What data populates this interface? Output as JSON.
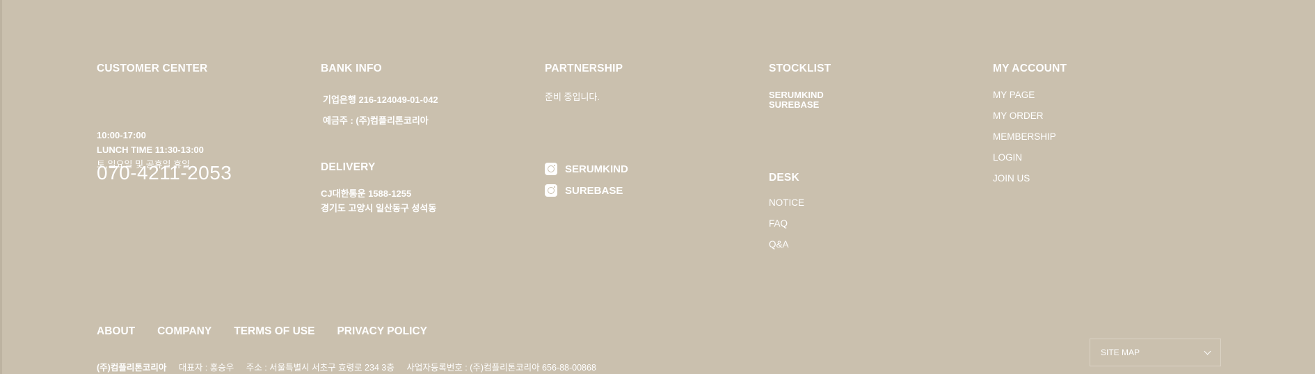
{
  "customer_center": {
    "title": "CUSTOMER CENTER",
    "phone": "070-4211-2053",
    "hours": "10:00-17:00",
    "lunch": "LUNCH TIME 11:30-13:00",
    "closed": "토,일요일 및 공휴일 휴일"
  },
  "bank_info": {
    "title": "BANK INFO",
    "account": "기업은행 216-124049-01-042",
    "holder": "예금주 : (주)컴플리톤코리아"
  },
  "delivery": {
    "title": "DELIVERY",
    "company": "CJ대한통운 1588-1255",
    "address": "경기도 고양시 일산동구 성석동"
  },
  "partnership": {
    "title": "PARTNERSHIP",
    "note": "준비 중입니다.",
    "sns": [
      {
        "label": "SERUMKIND",
        "icon": "instagram-icon"
      },
      {
        "label": "SUREBASE",
        "icon": "instagram-icon"
      }
    ]
  },
  "stocklist": {
    "title": "STOCKLIST",
    "items": [
      "SERUMKIND",
      "SUREBASE"
    ]
  },
  "desk": {
    "title": "DESK",
    "items": [
      "NOTICE",
      "FAQ",
      "Q&A"
    ]
  },
  "my_account": {
    "title": "MY ACCOUNT",
    "items": [
      "MY PAGE",
      "MY ORDER",
      "MEMBERSHIP",
      "LOGIN",
      "JOIN US"
    ]
  },
  "bottom_nav": [
    "ABOUT",
    "COMPANY",
    "TERMS OF USE",
    "PRIVACY POLICY"
  ],
  "company_info": {
    "name": "(주)컴플리톤코리아",
    "ceo": "대표자 : 홍승우",
    "address": "주소 : 서울특별시 서초구 효령로 234 3층",
    "business_no": "사업자등록번호 : (주)컴플리톤코리아 656-88-00868"
  },
  "site_map": {
    "label": "SITE MAP",
    "icon": "chevron-down-icon"
  },
  "colors": {
    "background": "#cac0ae",
    "text": "#ffffff"
  }
}
